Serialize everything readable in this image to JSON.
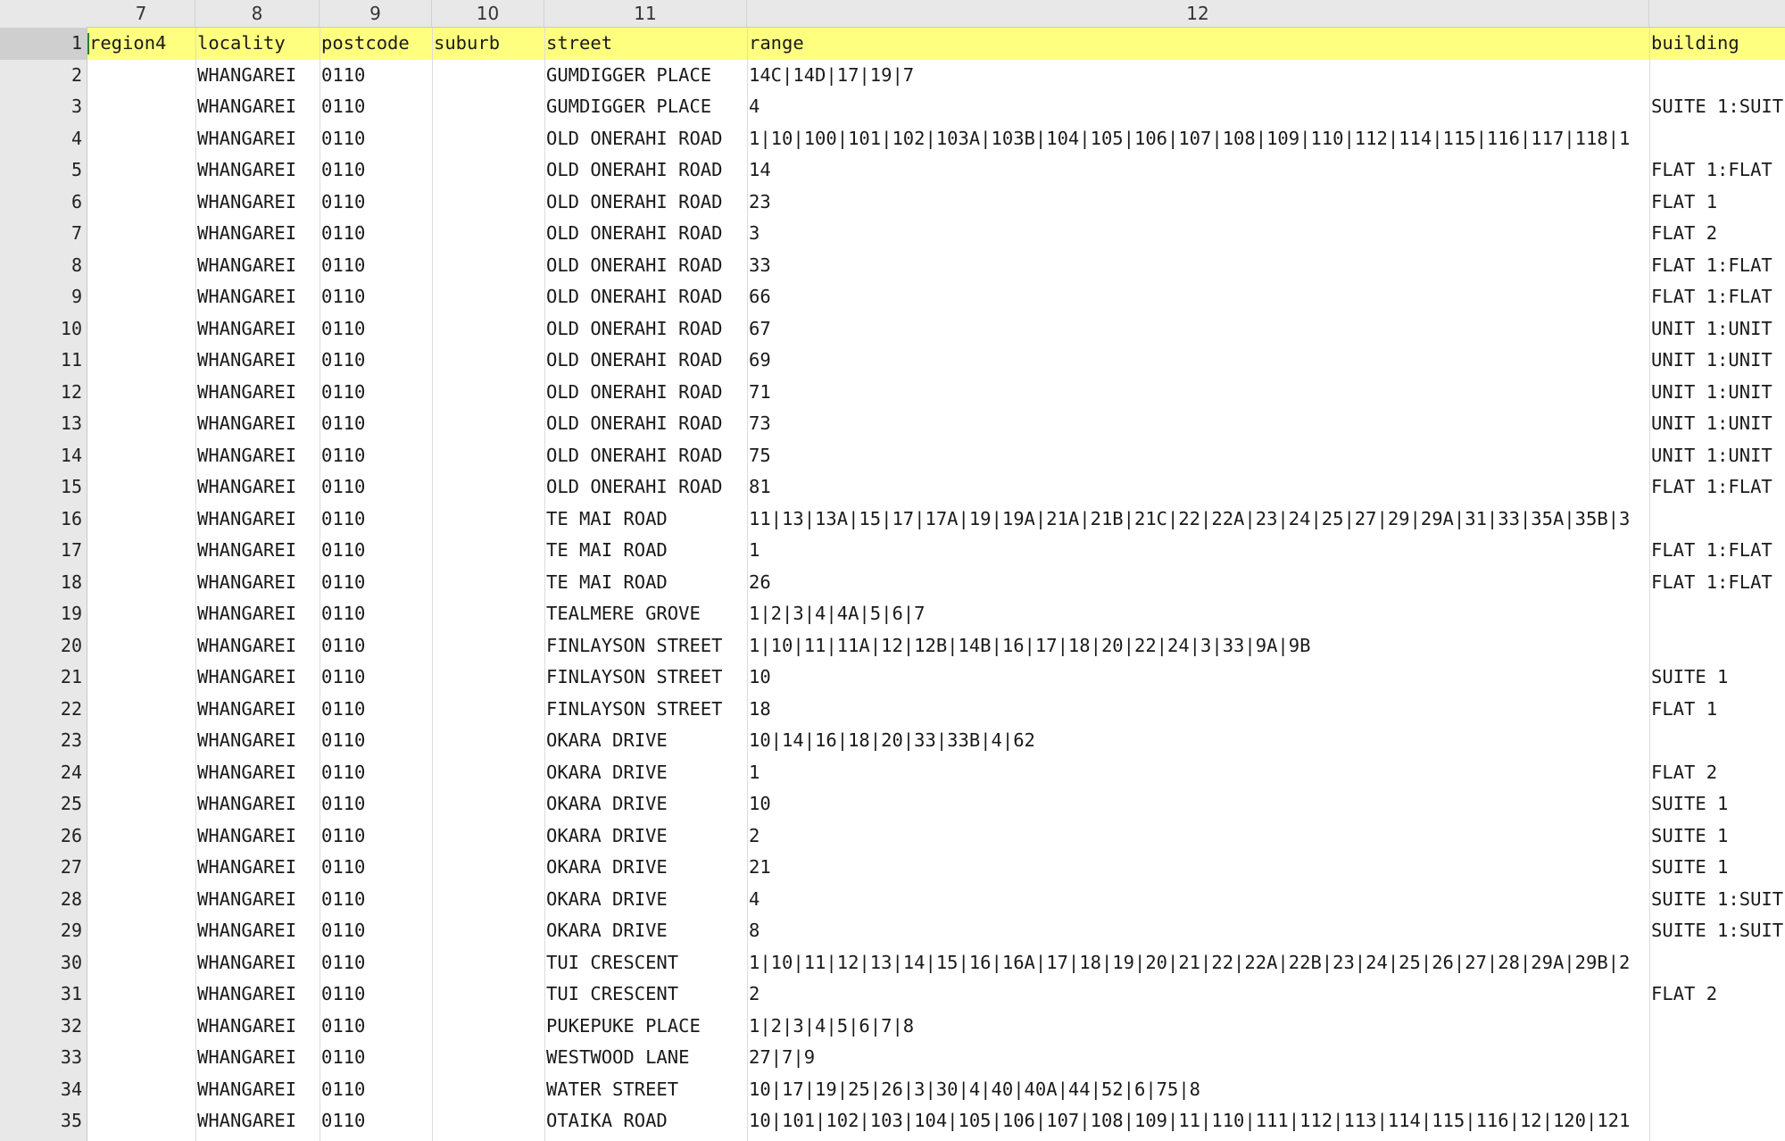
{
  "column_header_numbers": [
    "7",
    "8",
    "9",
    "10",
    "11",
    "12"
  ],
  "row_numbers": [
    "1",
    "2",
    "3",
    "4",
    "5",
    "6",
    "7",
    "8",
    "9",
    "10",
    "11",
    "12",
    "13",
    "14",
    "15",
    "16",
    "17",
    "18",
    "19",
    "20",
    "21",
    "22",
    "23",
    "24",
    "25",
    "26",
    "27",
    "28",
    "29",
    "30",
    "31",
    "32",
    "33",
    "34",
    "35"
  ],
  "selected_row": "1",
  "header_row": {
    "region4": "region4",
    "locality": "locality",
    "postcode": "postcode",
    "suburb": "suburb",
    "street": "street",
    "range": "range",
    "building": "building"
  },
  "rows": [
    {
      "region4": "",
      "locality": "WHANGAREI",
      "postcode": "0110",
      "suburb": "",
      "street": "GUMDIGGER PLACE",
      "range": "14C|14D|17|19|7",
      "building": ""
    },
    {
      "region4": "",
      "locality": "WHANGAREI",
      "postcode": "0110",
      "suburb": "",
      "street": "GUMDIGGER PLACE",
      "range": "4",
      "building": "SUITE 1:SUIT"
    },
    {
      "region4": "",
      "locality": "WHANGAREI",
      "postcode": "0110",
      "suburb": "",
      "street": "OLD ONERAHI ROAD",
      "range": "1|10|100|101|102|103A|103B|104|105|106|107|108|109|110|112|114|115|116|117|118|1",
      "building": ""
    },
    {
      "region4": "",
      "locality": "WHANGAREI",
      "postcode": "0110",
      "suburb": "",
      "street": "OLD ONERAHI ROAD",
      "range": "14",
      "building": "FLAT 1:FLAT"
    },
    {
      "region4": "",
      "locality": "WHANGAREI",
      "postcode": "0110",
      "suburb": "",
      "street": "OLD ONERAHI ROAD",
      "range": "23",
      "building": "FLAT 1"
    },
    {
      "region4": "",
      "locality": "WHANGAREI",
      "postcode": "0110",
      "suburb": "",
      "street": "OLD ONERAHI ROAD",
      "range": "3",
      "building": "FLAT 2"
    },
    {
      "region4": "",
      "locality": "WHANGAREI",
      "postcode": "0110",
      "suburb": "",
      "street": "OLD ONERAHI ROAD",
      "range": "33",
      "building": "FLAT 1:FLAT"
    },
    {
      "region4": "",
      "locality": "WHANGAREI",
      "postcode": "0110",
      "suburb": "",
      "street": "OLD ONERAHI ROAD",
      "range": "66",
      "building": "FLAT 1:FLAT"
    },
    {
      "region4": "",
      "locality": "WHANGAREI",
      "postcode": "0110",
      "suburb": "",
      "street": "OLD ONERAHI ROAD",
      "range": "67",
      "building": "UNIT 1:UNIT"
    },
    {
      "region4": "",
      "locality": "WHANGAREI",
      "postcode": "0110",
      "suburb": "",
      "street": "OLD ONERAHI ROAD",
      "range": "69",
      "building": "UNIT 1:UNIT"
    },
    {
      "region4": "",
      "locality": "WHANGAREI",
      "postcode": "0110",
      "suburb": "",
      "street": "OLD ONERAHI ROAD",
      "range": "71",
      "building": "UNIT 1:UNIT"
    },
    {
      "region4": "",
      "locality": "WHANGAREI",
      "postcode": "0110",
      "suburb": "",
      "street": "OLD ONERAHI ROAD",
      "range": "73",
      "building": "UNIT 1:UNIT"
    },
    {
      "region4": "",
      "locality": "WHANGAREI",
      "postcode": "0110",
      "suburb": "",
      "street": "OLD ONERAHI ROAD",
      "range": "75",
      "building": "UNIT 1:UNIT"
    },
    {
      "region4": "",
      "locality": "WHANGAREI",
      "postcode": "0110",
      "suburb": "",
      "street": "OLD ONERAHI ROAD",
      "range": "81",
      "building": "FLAT 1:FLAT"
    },
    {
      "region4": "",
      "locality": "WHANGAREI",
      "postcode": "0110",
      "suburb": "",
      "street": "TE MAI ROAD",
      "range": "11|13|13A|15|17|17A|19|19A|21A|21B|21C|22|22A|23|24|25|27|29|29A|31|33|35A|35B|3",
      "building": ""
    },
    {
      "region4": "",
      "locality": "WHANGAREI",
      "postcode": "0110",
      "suburb": "",
      "street": "TE MAI ROAD",
      "range": "1",
      "building": "FLAT 1:FLAT"
    },
    {
      "region4": "",
      "locality": "WHANGAREI",
      "postcode": "0110",
      "suburb": "",
      "street": "TE MAI ROAD",
      "range": "26",
      "building": "FLAT 1:FLAT"
    },
    {
      "region4": "",
      "locality": "WHANGAREI",
      "postcode": "0110",
      "suburb": "",
      "street": "TEALMERE GROVE",
      "range": "1|2|3|4|4A|5|6|7",
      "building": ""
    },
    {
      "region4": "",
      "locality": "WHANGAREI",
      "postcode": "0110",
      "suburb": "",
      "street": "FINLAYSON STREET",
      "range": "1|10|11|11A|12|12B|14B|16|17|18|20|22|24|3|33|9A|9B",
      "building": ""
    },
    {
      "region4": "",
      "locality": "WHANGAREI",
      "postcode": "0110",
      "suburb": "",
      "street": "FINLAYSON STREET",
      "range": "10",
      "building": "SUITE 1"
    },
    {
      "region4": "",
      "locality": "WHANGAREI",
      "postcode": "0110",
      "suburb": "",
      "street": "FINLAYSON STREET",
      "range": "18",
      "building": "FLAT 1"
    },
    {
      "region4": "",
      "locality": "WHANGAREI",
      "postcode": "0110",
      "suburb": "",
      "street": "OKARA DRIVE",
      "range": "10|14|16|18|20|33|33B|4|62",
      "building": ""
    },
    {
      "region4": "",
      "locality": "WHANGAREI",
      "postcode": "0110",
      "suburb": "",
      "street": "OKARA DRIVE",
      "range": "1",
      "building": "FLAT 2"
    },
    {
      "region4": "",
      "locality": "WHANGAREI",
      "postcode": "0110",
      "suburb": "",
      "street": "OKARA DRIVE",
      "range": "10",
      "building": "SUITE 1"
    },
    {
      "region4": "",
      "locality": "WHANGAREI",
      "postcode": "0110",
      "suburb": "",
      "street": "OKARA DRIVE",
      "range": "2",
      "building": "SUITE 1"
    },
    {
      "region4": "",
      "locality": "WHANGAREI",
      "postcode": "0110",
      "suburb": "",
      "street": "OKARA DRIVE",
      "range": "21",
      "building": "SUITE 1"
    },
    {
      "region4": "",
      "locality": "WHANGAREI",
      "postcode": "0110",
      "suburb": "",
      "street": "OKARA DRIVE",
      "range": "4",
      "building": "SUITE 1:SUIT"
    },
    {
      "region4": "",
      "locality": "WHANGAREI",
      "postcode": "0110",
      "suburb": "",
      "street": "OKARA DRIVE",
      "range": "8",
      "building": "SUITE 1:SUIT"
    },
    {
      "region4": "",
      "locality": "WHANGAREI",
      "postcode": "0110",
      "suburb": "",
      "street": "TUI CRESCENT",
      "range": "1|10|11|12|13|14|15|16|16A|17|18|19|20|21|22|22A|22B|23|24|25|26|27|28|29A|29B|2",
      "building": ""
    },
    {
      "region4": "",
      "locality": "WHANGAREI",
      "postcode": "0110",
      "suburb": "",
      "street": "TUI CRESCENT",
      "range": "2",
      "building": "FLAT 2"
    },
    {
      "region4": "",
      "locality": "WHANGAREI",
      "postcode": "0110",
      "suburb": "",
      "street": "PUKEPUKE PLACE",
      "range": "1|2|3|4|5|6|7|8",
      "building": ""
    },
    {
      "region4": "",
      "locality": "WHANGAREI",
      "postcode": "0110",
      "suburb": "",
      "street": "WESTWOOD LANE",
      "range": "27|7|9",
      "building": ""
    },
    {
      "region4": "",
      "locality": "WHANGAREI",
      "postcode": "0110",
      "suburb": "",
      "street": "WATER STREET",
      "range": "10|17|19|25|26|3|30|4|40|40A|44|52|6|75|8",
      "building": ""
    },
    {
      "region4": "",
      "locality": "WHANGAREI",
      "postcode": "0110",
      "suburb": "",
      "street": "OTAIKA ROAD",
      "range": "10|101|102|103|104|105|106|107|108|109|11|110|111|112|113|114|115|116|12|120|121",
      "building": ""
    }
  ],
  "colors": {
    "header_row_bg": "#ffff7f",
    "gutter_bg": "#e8e8e8",
    "selected_row_bg": "#cfcfcf",
    "cursor": "#2e7d32"
  }
}
